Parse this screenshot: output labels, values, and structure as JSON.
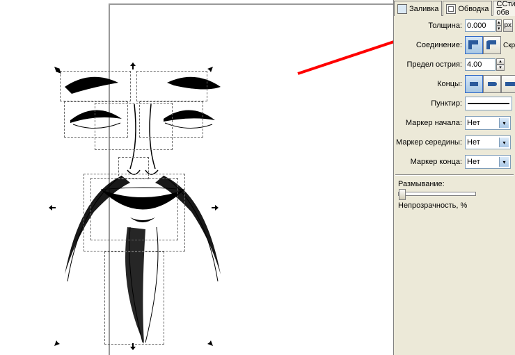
{
  "tabs": {
    "fill": {
      "label": "Заливка"
    },
    "stroke": {
      "label": "Обводка"
    },
    "style": {
      "label": "Стиль обв"
    }
  },
  "stroke": {
    "width_label": "Толщина:",
    "width_value": "0.000",
    "unit": "px",
    "join_label": "Соединение:",
    "join_round_label": "Скругл",
    "miter_label": "Предел острия:",
    "miter_value": "4.00",
    "cap_label": "Концы:",
    "dash_label": "Пунктир:",
    "marker_start_label": "Маркер начала:",
    "marker_mid_label": "Маркер середины:",
    "marker_end_label": "Маркер конца:",
    "marker_none": "Нет"
  },
  "fx": {
    "blur_label": "Размывание:",
    "opacity_label": "Непрозрачность, %"
  },
  "icons": {
    "spin_up": "▴",
    "spin_down": "▾",
    "drop": "▾"
  }
}
